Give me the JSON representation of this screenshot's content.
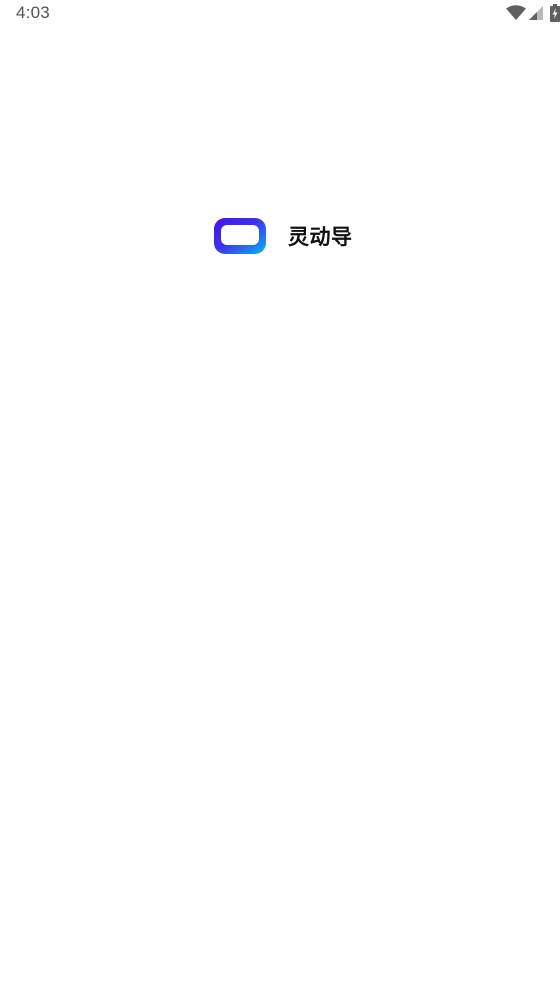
{
  "status_bar": {
    "time": "4:03",
    "icons": [
      "wifi-icon",
      "cellular-signal-icon",
      "battery-charging-icon"
    ]
  },
  "splash": {
    "logo_icon": "rounded-rectangle-logo-icon",
    "app_name": "灵动导",
    "colors": {
      "logo_gradient_start": "#4a12e6",
      "logo_gradient_end": "#0ab4ee",
      "background": "#ffffff"
    }
  }
}
